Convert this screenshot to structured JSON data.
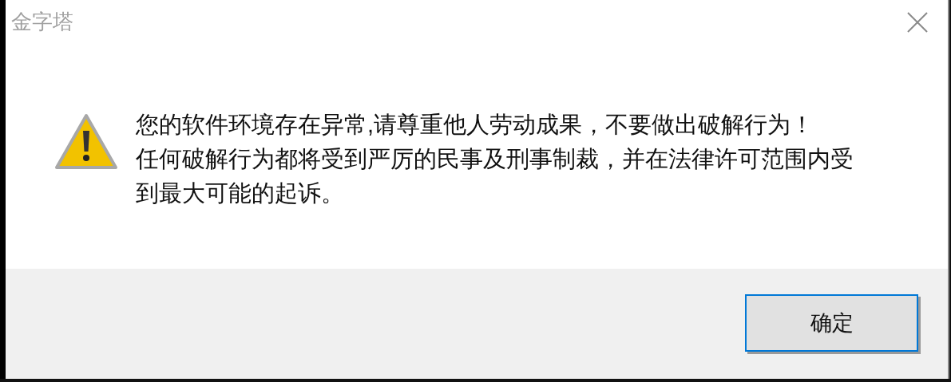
{
  "window": {
    "title": "金字塔"
  },
  "message": {
    "kind": "warning",
    "lines": [
      "您的软件环境存在异常,请尊重他人劳动成果，不要做出破解行为！",
      "任何破解行为都将受到严厉的民事及刑事制裁，并在法律许可范围内受到最大可能的起诉。"
    ]
  },
  "buttons": [
    {
      "label": "确定",
      "selected": true
    }
  ]
}
